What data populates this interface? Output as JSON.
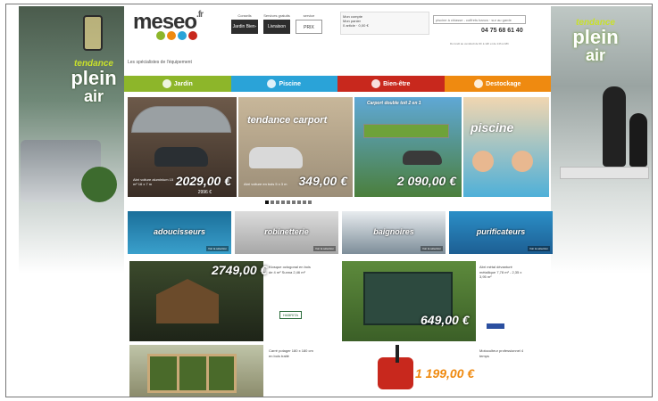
{
  "header": {
    "logo": "meseo",
    "logo_suffix": ".fr",
    "tagline": "Les spécialistes de l'équipement",
    "links": [
      {
        "label": "Conseils",
        "box": "Jardin Bien-être"
      },
      {
        "label": "Services gratuits",
        "box": "Livraison"
      },
      {
        "label": "service",
        "box": "PRIX"
      }
    ],
    "account": {
      "title": "Mon compte",
      "cart": "Mon panier",
      "line": "0 article · 0,00 €"
    },
    "search_placeholder": "piscine à chiasse - coffrets bancs · sur au garde",
    "phone": "04 75 68 61 40",
    "hours": "Du lundi au vendredi de 9h à 12h et de 14h à 18h"
  },
  "side": {
    "left_title": [
      "tendance",
      "plein",
      "air"
    ],
    "right_title": [
      "tendance",
      "plein",
      "air"
    ]
  },
  "nav": [
    {
      "label": "Jardin",
      "color": "#8db62a"
    },
    {
      "label": "Piscine",
      "color": "#2aa3d8"
    },
    {
      "label": "Bien-être",
      "color": "#c8281d"
    },
    {
      "label": "Destockage",
      "color": "#ef8a10"
    }
  ],
  "slides": [
    {
      "caption": "Abri voiture aluminium 15 m² 16 x 7 m",
      "price": "2029,00 €",
      "old": "2996 €"
    },
    {
      "title": "tendance carport",
      "caption": "Abri voiture en bois 5 x 3 m",
      "price": "349,00 €"
    },
    {
      "title": "Carport double toit 2 en 1",
      "price": "2 090,00 €"
    },
    {
      "title": "piscine"
    }
  ],
  "slider_dots": 9,
  "categories": [
    "adoucisseurs",
    "robinetterie",
    "baignoires",
    "purificateurs"
  ],
  "category_more": "Voir la sélection",
  "products": [
    {
      "price": "2749,00 €",
      "desc": "Kiosque octogonal en bois de 4 m² Sunna 2,46 m²",
      "brand": "HABRITA"
    },
    {
      "price": "649,00 €",
      "desc": "Abri métal dévanturé métallique 7,78 m² - 2,35 x 3,95 m²"
    },
    {
      "desc": "Carré potager 180 x 180 cm en bois traité"
    },
    {
      "price": "1 199,00 €",
      "desc": "Motoculteur professionnel 4 temps"
    }
  ]
}
